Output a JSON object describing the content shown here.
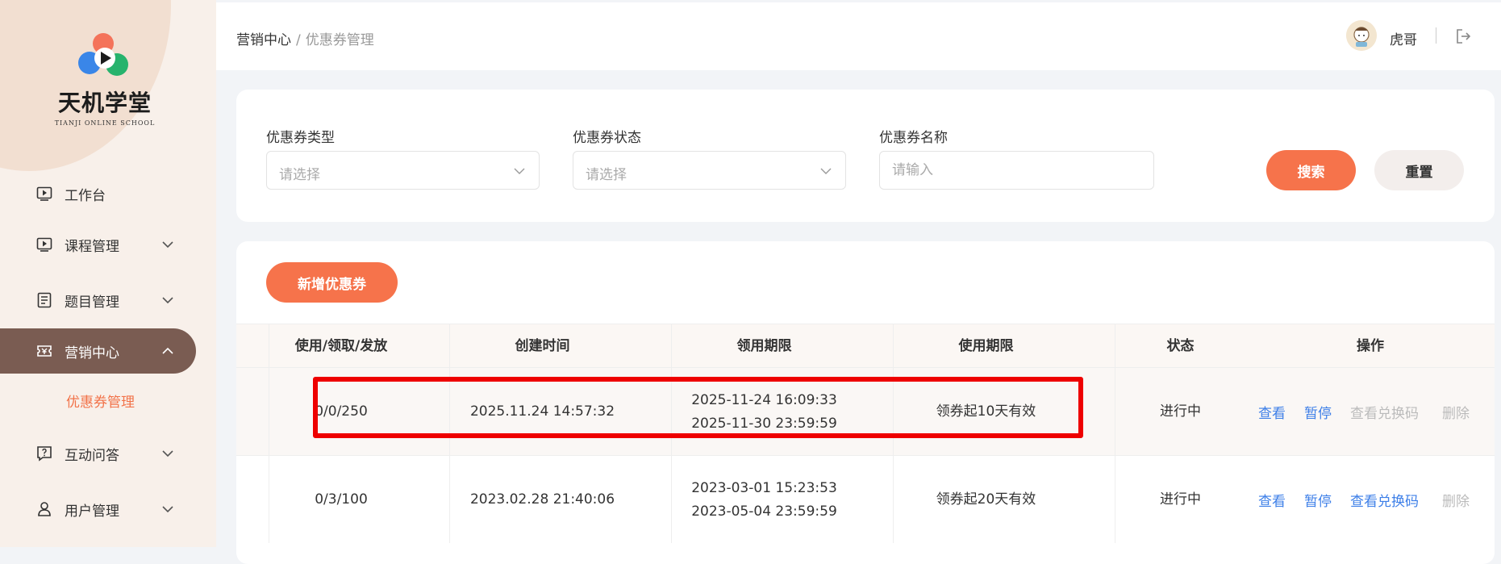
{
  "brand": {
    "name": "天机学堂",
    "subtitle": "TIANJI ONLINE SCHOOL"
  },
  "sidebar": {
    "items": [
      {
        "label": "工作台",
        "icon": "play-square-icon",
        "expandable": false
      },
      {
        "label": "课程管理",
        "icon": "play-square-icon",
        "expandable": true
      },
      {
        "label": "题目管理",
        "icon": "document-list-icon",
        "expandable": true
      },
      {
        "label": "营销中心",
        "icon": "ticket-icon",
        "expandable": true,
        "active": true,
        "sub": [
          "优惠券管理"
        ]
      },
      {
        "label": "互动问答",
        "icon": "question-chat-icon",
        "expandable": true
      },
      {
        "label": "用户管理",
        "icon": "user-icon",
        "expandable": true
      }
    ]
  },
  "header": {
    "breadcrumb": {
      "parent": "营销中心",
      "separator": "/",
      "current": "优惠券管理"
    },
    "username": "虎哥"
  },
  "filters": {
    "type": {
      "label": "优惠券类型",
      "placeholder": "请选择"
    },
    "status": {
      "label": "优惠券状态",
      "placeholder": "请选择"
    },
    "name": {
      "label": "优惠券名称",
      "placeholder": "请输入"
    },
    "search_label": "搜索",
    "reset_label": "重置"
  },
  "table": {
    "add_label": "新增优惠券",
    "columns": [
      "使用/领取/发放",
      "创建时间",
      "领用期限",
      "使用期限",
      "状态",
      "操作"
    ],
    "rows": [
      {
        "counts": "0/0/250",
        "created": "2025.11.24 14:57:32",
        "claim_start": "2025-11-24 16:09:33",
        "claim_end": "2025-11-30 23:59:59",
        "use_period": "领券起10天有效",
        "status": "进行中",
        "ops": {
          "view": "查看",
          "pause": "暂停",
          "view_codes": "查看兑换码",
          "delete": "删除"
        }
      },
      {
        "counts": "0/3/100",
        "created": "2023.02.28 21:40:06",
        "claim_start": "2023-03-01 15:23:53",
        "claim_end": "2023-05-04 23:59:59",
        "use_period": "领券起20天有效",
        "status": "进行中",
        "ops": {
          "view": "查看",
          "pause": "暂停",
          "view_codes": "查看兑换码",
          "delete": "删除"
        }
      }
    ]
  },
  "colors": {
    "accent": "#f6734b",
    "active_menu": "#7a5c52",
    "link": "#3d7fe8",
    "highlight_box": "#ee0000"
  }
}
